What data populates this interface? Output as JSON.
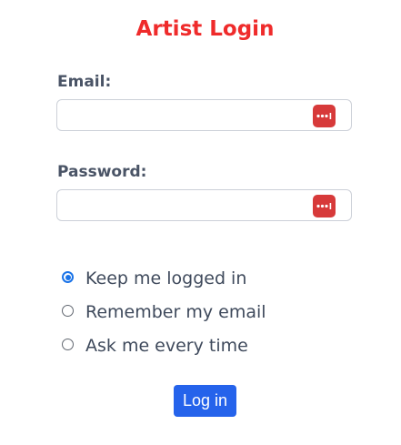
{
  "page": {
    "title": "Artist Login"
  },
  "form": {
    "email": {
      "label": "Email:",
      "value": "",
      "placeholder": ""
    },
    "password": {
      "label": "Password:",
      "value": "",
      "placeholder": ""
    },
    "autofill_icon": "password-manager-icon"
  },
  "login_options": {
    "selected": "Keep me logged in",
    "options": [
      {
        "label": "Keep me logged in",
        "checked": true
      },
      {
        "label": "Remember my email",
        "checked": false
      },
      {
        "label": "Ask me every time",
        "checked": false
      }
    ]
  },
  "actions": {
    "login_label": "Log in"
  },
  "colors": {
    "title": "#ef2b2b",
    "button": "#2563eb",
    "radio_selected": "#1a73e8",
    "password_manager_icon": "#d73a3a"
  }
}
